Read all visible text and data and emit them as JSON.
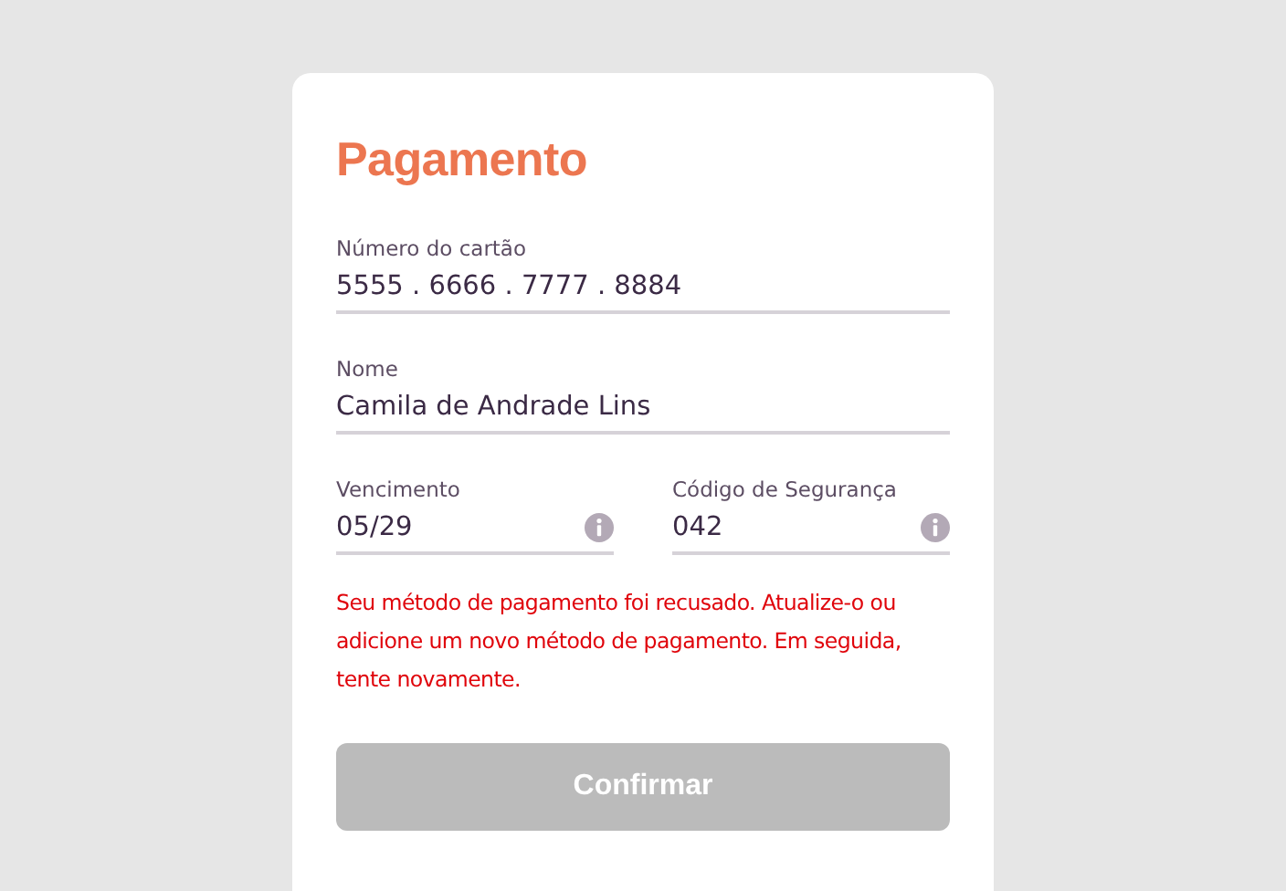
{
  "title": "Pagamento",
  "fields": [
    {
      "label": "Número do cartão",
      "value": "5555 . 6666 . 7777 . 8884",
      "info": false
    },
    {
      "label": "Nome",
      "value": "Camila de Andrade Lins",
      "info": false
    }
  ],
  "row_fields": [
    {
      "label": "Vencimento",
      "value": "05/29",
      "info": true
    },
    {
      "label": "Código de Segurança",
      "value": "042",
      "info": true
    }
  ],
  "error": "Seu método de pagamento foi recusado. Atualize-o ou adicione um novo método de pagamento. Em seguida, tente novamente.",
  "button": {
    "label": "Confirmar",
    "disabled": true
  }
}
